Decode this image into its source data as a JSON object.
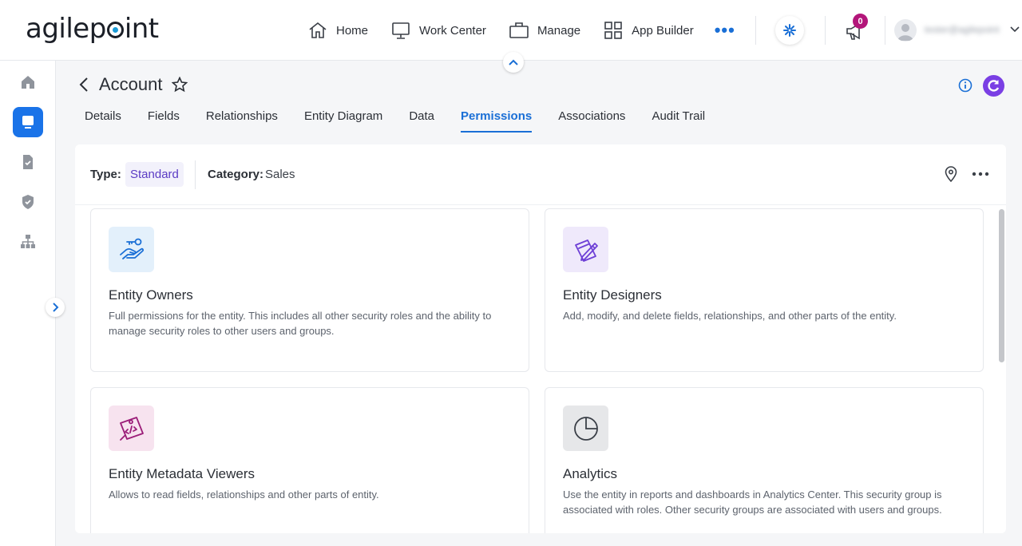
{
  "app": {
    "logo_text": "agilepoint"
  },
  "nav": {
    "items": [
      {
        "label": "Home",
        "icon": "home-icon"
      },
      {
        "label": "Work Center",
        "icon": "monitor-icon"
      },
      {
        "label": "Manage",
        "icon": "briefcase-icon"
      },
      {
        "label": "App Builder",
        "icon": "grid-icon"
      }
    ],
    "more": "•••"
  },
  "notifications": {
    "count": "0"
  },
  "user": {
    "name": "tester@agilepoint"
  },
  "header": {
    "title": "Account"
  },
  "tabs": [
    {
      "label": "Details"
    },
    {
      "label": "Fields"
    },
    {
      "label": "Relationships"
    },
    {
      "label": "Entity Diagram"
    },
    {
      "label": "Data"
    },
    {
      "label": "Permissions",
      "active": true
    },
    {
      "label": "Associations"
    },
    {
      "label": "Audit Trail"
    }
  ],
  "info": {
    "type_label": "Type:",
    "type_value": "Standard",
    "category_label": "Category:",
    "category_value": "Sales"
  },
  "cards": [
    {
      "title": "Entity Owners",
      "description": "Full permissions for the entity. This includes all other security roles and the ability to manage security roles to other users and groups.",
      "icon": "key-hand-icon",
      "icon_bg": "#e3f0fb"
    },
    {
      "title": "Entity Designers",
      "description": "Add, modify, and delete fields, relationships, and other parts of the entity.",
      "icon": "design-pencil-icon",
      "icon_bg": "#efe9fb"
    },
    {
      "title": "Entity Metadata Viewers",
      "description": "Allows to read fields, relationships and other parts of entity.",
      "icon": "code-view-icon",
      "icon_bg": "#f7e3ef"
    },
    {
      "title": "Analytics",
      "description": "Use the entity in reports and dashboards in Analytics Center. This security group is associated with roles. Other security groups are associated with users and groups.",
      "icon": "pie-chart-icon",
      "icon_bg": "#e6e7e9"
    }
  ],
  "colors": {
    "accent": "#1a6fd6",
    "badge": "#b3167a",
    "active_sidebar": "#1a73e8"
  }
}
